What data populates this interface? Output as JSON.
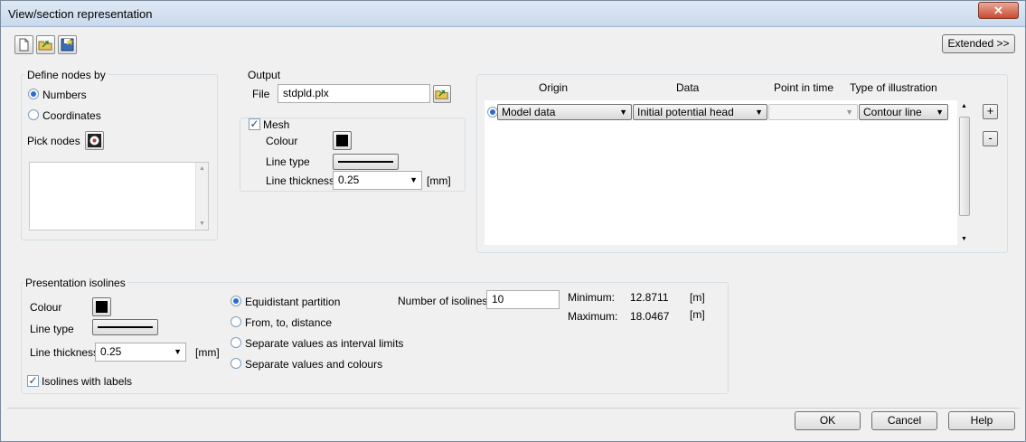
{
  "window": {
    "title": "View/section representation",
    "close_label": "✕"
  },
  "toolbar": {
    "icons": [
      "new-document-icon",
      "open-folder-icon",
      "save-icon"
    ],
    "extended_label": "Extended >>"
  },
  "define_nodes": {
    "group_label": "Define nodes by",
    "options": [
      "Numbers",
      "Coordinates"
    ],
    "selected": "Numbers",
    "pick_nodes_label": "Pick nodes"
  },
  "output": {
    "group_label": "Output",
    "file_label": "File",
    "file_value": "stdpld.plx"
  },
  "mesh": {
    "checkbox_label": "Mesh",
    "checked": true,
    "colour_label": "Colour",
    "line_type_label": "Line type",
    "line_thickness_label": "Line thickness",
    "line_thickness_value": "0.25",
    "unit": "[mm]"
  },
  "table": {
    "headers": [
      "Origin",
      "Data",
      "Point in time",
      "Type of illustration"
    ],
    "rows": [
      {
        "origin": "Model data",
        "data": "Initial potential head",
        "point_in_time": "",
        "illustration": "Contour line"
      }
    ],
    "add_label": "+",
    "remove_label": "-"
  },
  "isolines": {
    "group_label": "Presentation isolines",
    "colour_label": "Colour",
    "line_type_label": "Line type",
    "line_thickness_label": "Line thickness",
    "line_thickness_value": "0.25",
    "unit": "[mm]",
    "with_labels_label": "Isolines with labels",
    "with_labels_checked": true,
    "partition_options": [
      "Equidistant partition",
      "From, to, distance",
      "Separate values as interval limits",
      "Separate values and colours"
    ],
    "partition_selected": "Equidistant partition",
    "number_label": "Number of isolines",
    "number_value": "10",
    "minimum_label": "Minimum:",
    "minimum_value": "12.8711",
    "maximum_label": "Maximum:",
    "maximum_value": "18.0467",
    "value_unit": "[m]"
  },
  "footer": {
    "ok_label": "OK",
    "cancel_label": "Cancel",
    "help_label": "Help"
  }
}
